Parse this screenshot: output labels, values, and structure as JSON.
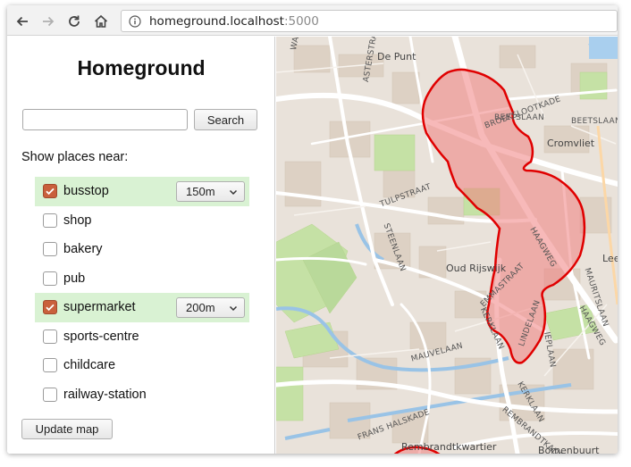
{
  "browser": {
    "url_host": "homeground.localhost",
    "url_port": ":5000"
  },
  "panel": {
    "title": "Homeground",
    "search_value": "",
    "search_button": "Search",
    "near_label": "Show places near:",
    "places": [
      {
        "label": "busstop",
        "checked": true,
        "distance": "150m"
      },
      {
        "label": "shop",
        "checked": false
      },
      {
        "label": "bakery",
        "checked": false
      },
      {
        "label": "pub",
        "checked": false
      },
      {
        "label": "supermarket",
        "checked": true,
        "distance": "200m"
      },
      {
        "label": "sports-centre",
        "checked": false
      },
      {
        "label": "childcare",
        "checked": false
      },
      {
        "label": "railway-station",
        "checked": false
      }
    ],
    "update_button": "Update map"
  },
  "map": {
    "labels": {
      "van_wassenaerstraat": "VAN WASSENAERSTRAAT",
      "de_punt": "De Punt",
      "broekslootkade": "BROEKSLOOTKADE",
      "beetslaan_1": "BEETSLAAN",
      "beetslaan_2": "BEETSLAAN",
      "cromvliet": "Cromvliet",
      "tulpstraat": "TULPSTRAAT",
      "steenlaan": "STEENLAAN",
      "haagweg_1": "HAAGWEG",
      "haagweg_2": "HAAGWEG",
      "oud_rijswijk": "Oud Rijswijk",
      "emmastraat": "EMMASTRAAT",
      "lindelaan": "LINDELAAN",
      "kerklaan_1": "KERKLAAN",
      "kerklaan_2": "KERKLAAN",
      "mauvelaan": "MAUVELAAN",
      "frans_halskade": "FRANS HALSKADE",
      "rembrandtkwartier": "Rembrandtkwartier",
      "rembrandtkade": "REMBRANDTKADE",
      "bomenbuurt": "Bomenbuurt",
      "maurits": "MAURITSLAAN",
      "ieplaan": "IEPLAAN",
      "lee": "Lee",
      "asterstraat": "ASTERSTRAAT",
      "wal": "WASSENAERSTRAAT"
    },
    "highlight_color": "#f08080",
    "outline_color": "#e00000"
  }
}
